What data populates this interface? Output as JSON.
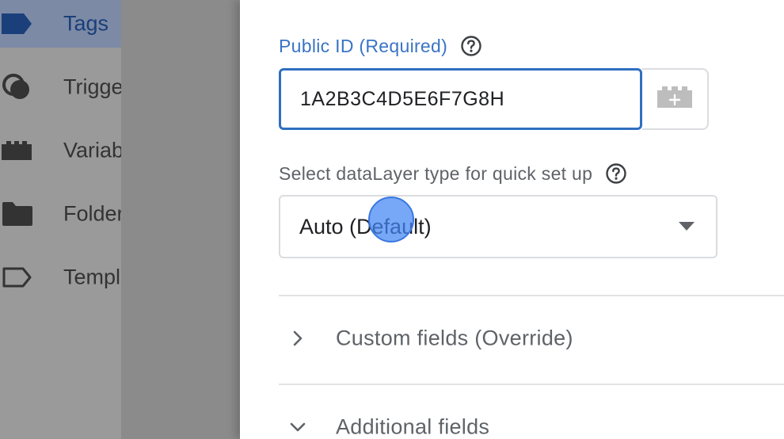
{
  "sidebar": {
    "items": [
      {
        "label": "Tags",
        "icon": "tag-icon",
        "active": true
      },
      {
        "label": "Triggers",
        "icon": "trigger-icon",
        "active": false
      },
      {
        "label": "Variables",
        "icon": "variable-icon",
        "active": false
      },
      {
        "label": "Folders",
        "icon": "folder-icon",
        "active": false
      },
      {
        "label": "Templates",
        "icon": "template-icon",
        "active": false
      }
    ]
  },
  "form": {
    "public_id": {
      "label": "Public ID (Required)",
      "value": "1A2B3C4D5E6F7G8H",
      "help_icon": "help-circle-icon",
      "variable_button_icon": "add-variable-icon"
    },
    "datalayer_type": {
      "label": "Select dataLayer type for quick set up",
      "help_icon": "help-circle-icon",
      "selected": "Auto (Default)"
    },
    "sections": [
      {
        "label": "Custom fields (Override)",
        "expanded": false
      },
      {
        "label": "Additional fields",
        "expanded": true
      }
    ]
  },
  "colors": {
    "accent": "#3a74c6",
    "input_border_focus": "#2f6fc0",
    "nav_active_text": "#1a3f7a",
    "click_marker": "#4285f4"
  }
}
